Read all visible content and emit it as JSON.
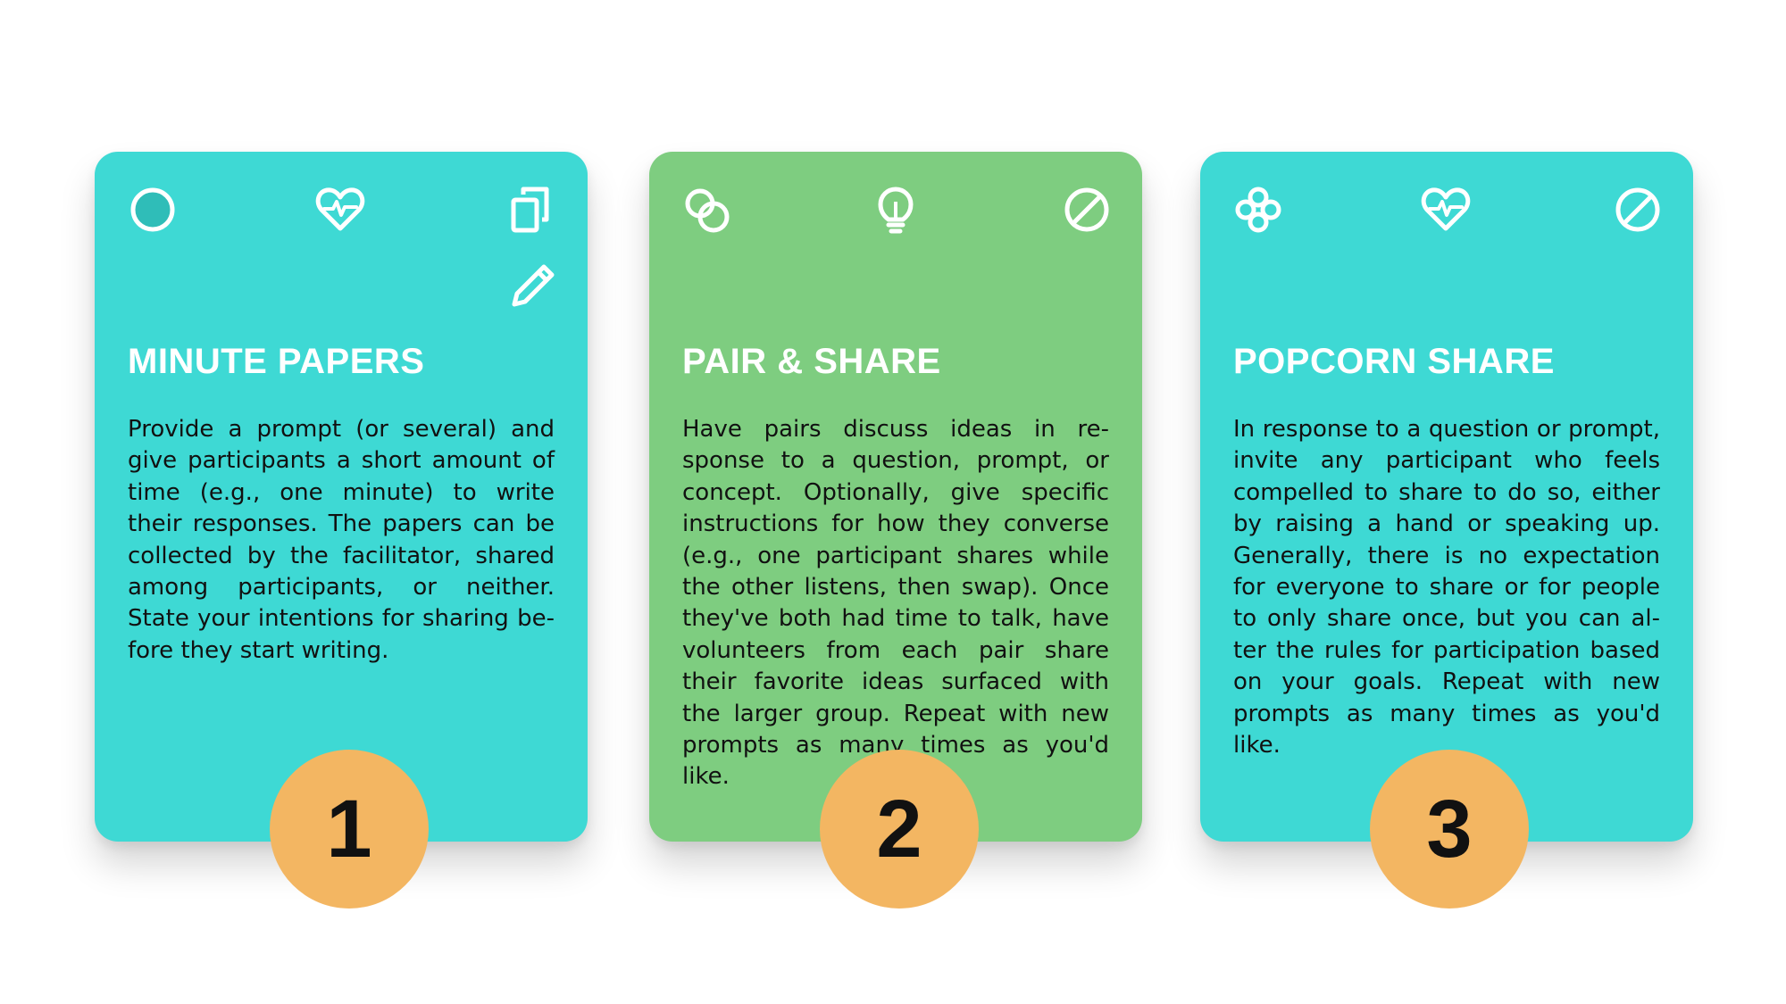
{
  "colors": {
    "teal": "#3ed9d4",
    "green": "#7ecd80",
    "badge": "#f3b662",
    "icon": "#ffffff"
  },
  "cards": [
    {
      "title": "MINUTE PAPERS",
      "body": "Provide a prompt (or several) and give participants a short amount of time (e.g., one minute) to write their responses. The papers can be col­lected by the facilitator, shared among participants, or neither. State your intentions for sharing be­fore they start writing.",
      "badge": "1",
      "color": "#3ed9d4",
      "icons": [
        "circle-icon",
        "heartbeat-icon",
        "copy-icon",
        "pencil-icon"
      ]
    },
    {
      "title": "PAIR & SHARE",
      "body": "Have pairs discuss ideas in re­sponse to a question, prompt, or concept. Optionally, give specific instructions for how they converse (e.g., one participant shares while the other listens, then swap). Once they've both had time to talk, have volunteers from each pair share their favorite ideas surfaced with the larger group. Repeat with new prompts as many times as you'd like.",
      "badge": "2",
      "color": "#7ecd80",
      "icons": [
        "overlapping-circles-icon",
        "lightbulb-icon",
        "slash-circle-icon"
      ]
    },
    {
      "title": "POPCORN SHARE",
      "body": "In response to a question or prompt, invite any participant who feels compelled to share to do so, either by raising a hand or speaking up. Generally, there is no expectation for everyone to share or for people to only share once, but you can al­ter the rules for participation based on your goals. Repeat with new prompts as many times as you'd like.",
      "badge": "3",
      "color": "#3ed9d4",
      "icons": [
        "circle-cluster-icon",
        "heartbeat-icon",
        "slash-circle-icon"
      ]
    }
  ]
}
